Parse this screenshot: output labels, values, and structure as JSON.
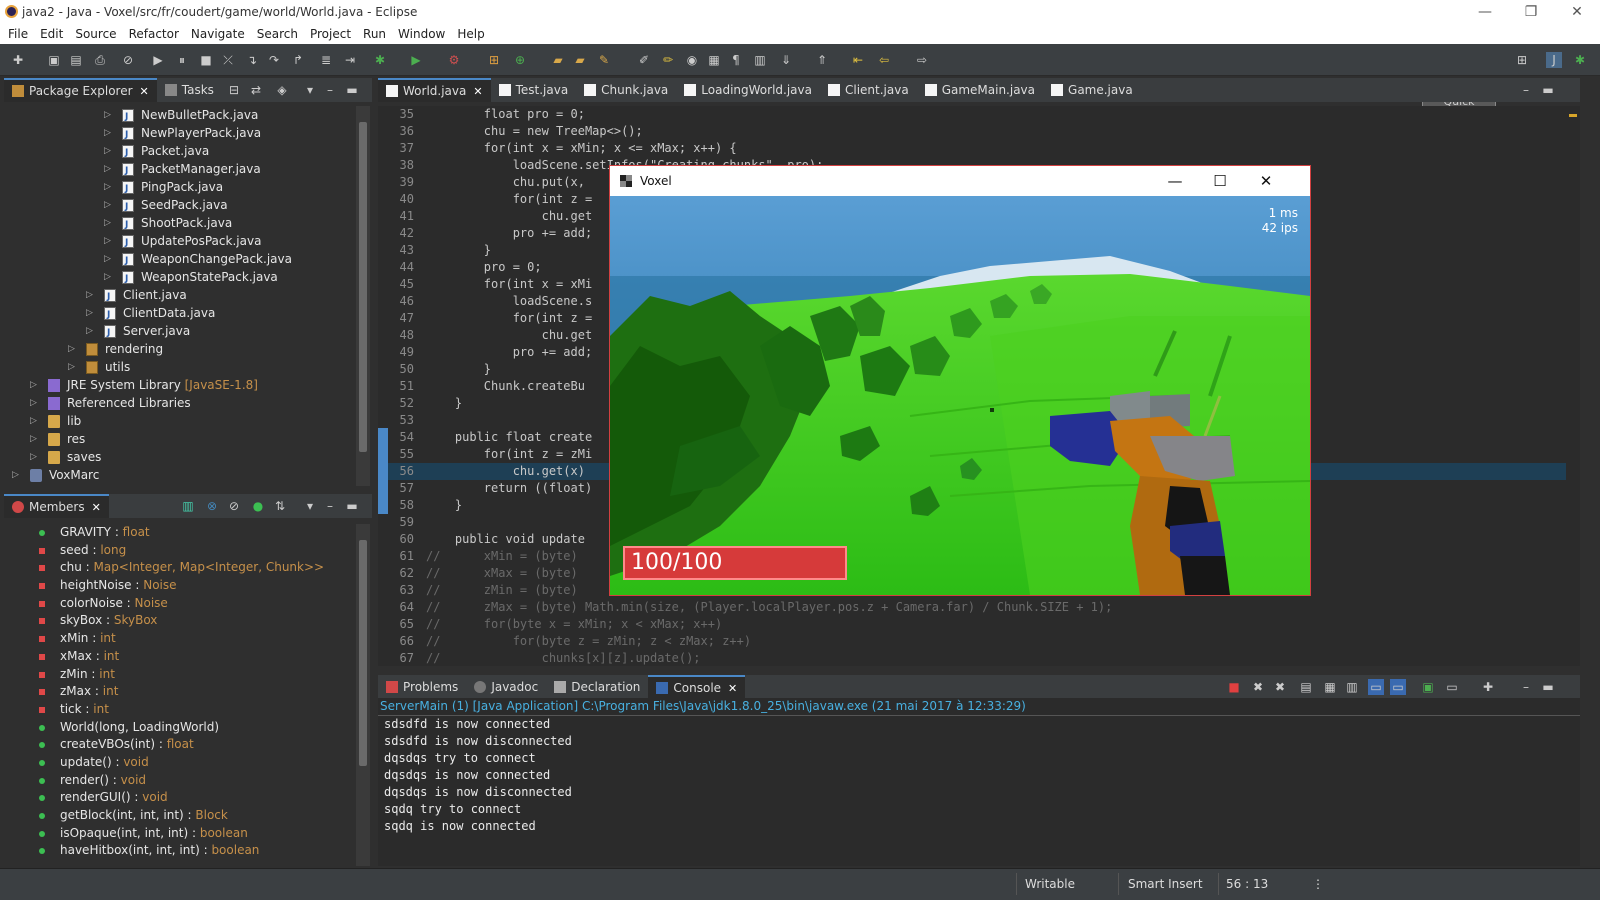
{
  "window": {
    "title": "java2 - Java - Voxel/src/fr/coudert/game/world/World.java - Eclipse"
  },
  "menu": [
    "File",
    "Edit",
    "Source",
    "Refactor",
    "Navigate",
    "Search",
    "Project",
    "Run",
    "Window",
    "Help"
  ],
  "toolbar": {
    "quick_access": "Quick Access"
  },
  "package_explorer": {
    "tabs": [
      {
        "label": "Package Explorer"
      },
      {
        "label": "Tasks"
      }
    ],
    "items": [
      {
        "label": "NewBulletPack.java",
        "suffix": ""
      },
      {
        "label": "NewPlayerPack.java",
        "suffix": ""
      },
      {
        "label": "Packet.java",
        "suffix": ""
      },
      {
        "label": "PacketManager.java",
        "suffix": ""
      },
      {
        "label": "PingPack.java",
        "suffix": ""
      },
      {
        "label": "SeedPack.java",
        "suffix": ""
      },
      {
        "label": "ShootPack.java",
        "suffix": ""
      },
      {
        "label": "UpdatePosPack.java",
        "suffix": ""
      },
      {
        "label": "WeaponChangePack.java",
        "suffix": ""
      },
      {
        "label": "WeaponStatePack.java",
        "suffix": ""
      },
      {
        "label": "Client.java",
        "suffix": ""
      },
      {
        "label": "ClientData.java",
        "suffix": ""
      },
      {
        "label": "Server.java",
        "suffix": ""
      },
      {
        "label": "rendering",
        "suffix": ""
      },
      {
        "label": "utils",
        "suffix": ""
      },
      {
        "label": "JRE System Library",
        "suffix": "[JavaSE-1.8]"
      },
      {
        "label": "Referenced Libraries",
        "suffix": ""
      },
      {
        "label": "lib",
        "suffix": ""
      },
      {
        "label": "res",
        "suffix": ""
      },
      {
        "label": "saves",
        "suffix": ""
      },
      {
        "label": "VoxMarc",
        "suffix": ""
      }
    ]
  },
  "members": {
    "tab": "Members",
    "items": [
      {
        "name": "GRAVITY",
        "type": "float"
      },
      {
        "name": "seed",
        "type": "long"
      },
      {
        "name": "chu",
        "type": "Map<Integer, Map<Integer, Chunk>>"
      },
      {
        "name": "heightNoise",
        "type": "Noise"
      },
      {
        "name": "colorNoise",
        "type": "Noise"
      },
      {
        "name": "skyBox",
        "type": "SkyBox"
      },
      {
        "name": "xMin",
        "type": "int"
      },
      {
        "name": "xMax",
        "type": "int"
      },
      {
        "name": "zMin",
        "type": "int"
      },
      {
        "name": "zMax",
        "type": "int"
      },
      {
        "name": "tick",
        "type": "int"
      },
      {
        "name": "World(long, LoadingWorld)",
        "type": ""
      },
      {
        "name": "createVBOs(int)",
        "type": "float"
      },
      {
        "name": "update()",
        "type": "void"
      },
      {
        "name": "render()",
        "type": "void"
      },
      {
        "name": "renderGUI()",
        "type": "void"
      },
      {
        "name": "getBlock(int, int, int)",
        "type": "Block"
      },
      {
        "name": "isOpaque(int, int, int)",
        "type": "boolean"
      },
      {
        "name": "haveHitbox(int, int, int)",
        "type": "boolean"
      }
    ]
  },
  "editor": {
    "tabs": [
      {
        "label": "World.java"
      },
      {
        "label": "Test.java"
      },
      {
        "label": "Chunk.java"
      },
      {
        "label": "LoadingWorld.java"
      },
      {
        "label": "Client.java"
      },
      {
        "label": "GameMain.java"
      },
      {
        "label": "Game.java"
      }
    ],
    "line_numbers": [
      "35",
      "36",
      "37",
      "38",
      "39",
      "40",
      "41",
      "42",
      "43",
      "44",
      "45",
      "46",
      "47",
      "48",
      "49",
      "50",
      "51",
      "52",
      "53",
      "54",
      "55",
      "56",
      "57",
      "58",
      "59",
      "60",
      "61",
      "62",
      "63",
      "64",
      "65",
      "66",
      "67"
    ],
    "code": [
      "        float pro = 0;",
      "        chu = new TreeMap<>();",
      "        for(int x = xMin; x <= xMax; x++) {",
      "            loadScene.setInfos(\"Creating chunks\", pro);",
      "            chu.put(x,",
      "            for(int z =",
      "                chu.get",
      "            pro += add;",
      "        }",
      "        pro = 0;",
      "        for(int x = xMi",
      "            loadScene.s",
      "            for(int z =",
      "                chu.get",
      "            pro += add;",
      "        }",
      "        Chunk.createBu",
      "    }",
      "",
      "    public float create",
      "        for(int z = zMi",
      "            chu.get(x)",
      "        return ((float)",
      "    }",
      "",
      "    public void update",
      "//      xMin = (byte)",
      "//      xMax = (byte)",
      "//      zMin = (byte)",
      "//      zMax = (byte) Math.min(size, (Player.localPlayer.pos.z + Camera.far) / Chunk.SIZE + 1);",
      "//      for(byte x = xMin; x < xMax; x++)",
      "//          for(byte z = zMin; z < zMax; z++)",
      "//              chunks[x][z].update();"
    ]
  },
  "bottom_panel": {
    "tabs": [
      {
        "label": "Problems"
      },
      {
        "label": "Javadoc"
      },
      {
        "label": "Declaration"
      },
      {
        "label": "Console"
      }
    ],
    "header": "ServerMain (1) [Java Application] C:\\Program Files\\Java\\jdk1.8.0_25\\bin\\javaw.exe (21 mai 2017 à 12:33:29)",
    "lines": [
      "sdsdfd is now connected",
      "sdsdfd is now disconnected",
      "dqsdqs try to connect",
      "dqsdqs is now connected",
      "dqsdqs is now disconnected",
      "sqdq try to connect",
      "sqdq is now connected"
    ]
  },
  "game_window": {
    "title": "Voxel",
    "frame_time": "1 ms",
    "fps": "42 ips",
    "health": "100/100"
  },
  "status": {
    "writable": "Writable",
    "insert_mode": "Smart Insert",
    "position": "56 : 13"
  }
}
